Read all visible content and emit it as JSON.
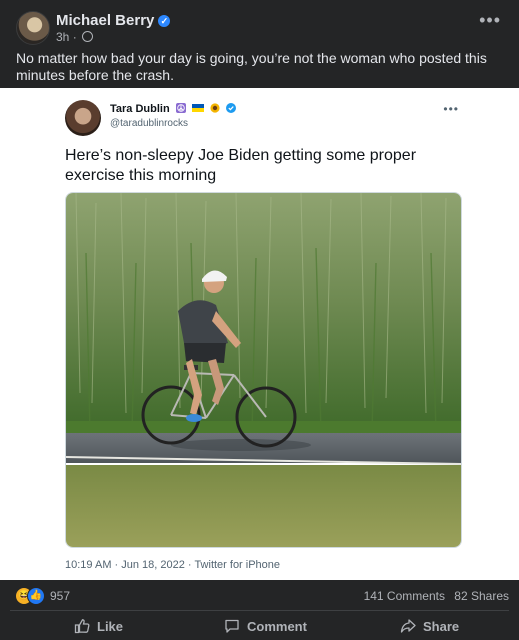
{
  "post": {
    "author": "Michael Berry",
    "time": "3h",
    "caption": "No matter how bad your day is going, you’re not the woman who posted this minutes before the crash."
  },
  "tweet": {
    "name": "Tara Dublin",
    "handle": "@taradublinrocks",
    "text": "Here’s non-sleepy Joe Biden getting some proper exercise this morning",
    "timestamp": "10:19 AM · Jun 18, 2022 · Twitter for iPhone"
  },
  "stats": {
    "reactions": "957",
    "comments": "141 Comments",
    "shares": "82 Shares"
  },
  "actions": {
    "like": "Like",
    "comment": "Comment",
    "share": "Share"
  },
  "icons": [
    "verified-icon",
    "globe-icon",
    "more-icon",
    "peace-icon",
    "ukraine-flag-icon",
    "sunflower-icon",
    "haha-reaction-icon",
    "like-reaction-icon",
    "like-icon",
    "comment-icon",
    "share-icon"
  ],
  "colors": {
    "background": "#242526",
    "text_primary": "#e4e6eb",
    "text_secondary": "#b0b3b8",
    "facebook_blue": "#2078f4",
    "twitter_blue": "#1d9bf0"
  }
}
